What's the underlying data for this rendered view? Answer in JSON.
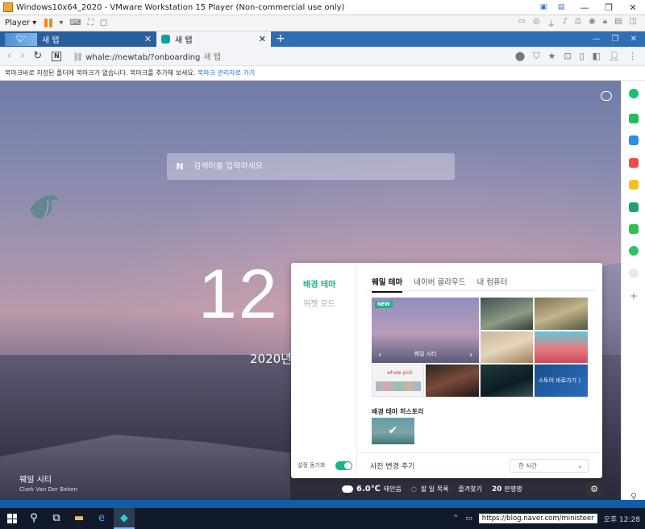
{
  "vm": {
    "title": "Windows10x64_2020 - VMware Workstation 15 Player (Non-commercial use only)",
    "player_label": "Player ▾",
    "window_controls": [
      "—",
      "❐",
      "✕"
    ]
  },
  "browser": {
    "tab1_title": "새 탭",
    "tab2_title": "새 탭",
    "address_url": "whale://newtab/?onboarding",
    "address_page_title": "새 탭",
    "bookmark_notice": "북마크바로 지정된 폴더에 북마크가 없습니다. 북마크를 추가해 보세요.",
    "bookmark_link": "북마크 관리자로 가기"
  },
  "newtab": {
    "search_placeholder": "검색어를 입력하세요",
    "clock": "12",
    "date": "2020년",
    "location_name": "웨일 시티",
    "location_credit": "Clark Van Der Beken"
  },
  "panel": {
    "left_items": [
      "배경 테마",
      "위젯 모드"
    ],
    "sync_label": "설정 동기화",
    "tabs": [
      "웨일 테마",
      "네이버 클라우드",
      "내 컴퓨터"
    ],
    "thumb_big_caption": "웨일 시티",
    "new_badge": "NEW",
    "whalepick_label": "whale pick",
    "store_label": "스토어 바로가기 〉",
    "history_title": "배경 테마 히스토리",
    "period_label": "사진 변경 주기",
    "period_value": "한 시간"
  },
  "widgets": {
    "temperature": "6.0℃",
    "weather_desc": "태안읍",
    "todo": "할 일 목록",
    "favorites": "즐겨찾기",
    "board_count": "20",
    "board_label": "판쟁쟁"
  },
  "taskbar": {
    "url_tip": "https://blog.naver.com/ministeer",
    "clock": "오후 12:28"
  },
  "colors": {
    "accent_green": "#12b886",
    "titlebar_blue": "#2f6db5"
  }
}
